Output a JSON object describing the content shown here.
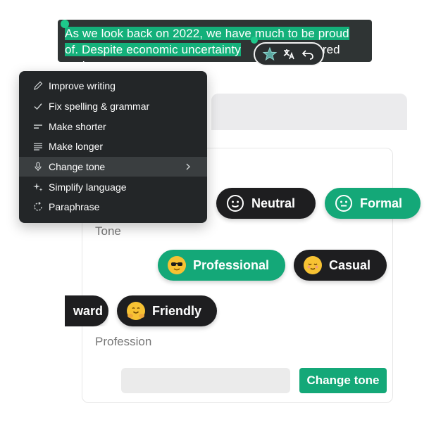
{
  "editor": {
    "line1": "As we look back on 2022, we have much to be proud",
    "line2_selected": "of. Despite economic uncertainty",
    "line2_rest": "red and"
  },
  "mini_toolbar": {
    "icons": [
      "ai-star-icon",
      "translate-icon",
      "undo-icon"
    ]
  },
  "ai_menu": {
    "items": [
      {
        "label": "Improve writing",
        "icon": "pencil-icon"
      },
      {
        "label": "Fix spelling & grammar",
        "icon": "check-icon"
      },
      {
        "label": "Make shorter",
        "icon": "short-lines-icon"
      },
      {
        "label": "Make longer",
        "icon": "long-lines-icon"
      },
      {
        "label": "Change tone",
        "icon": "microphone-icon",
        "active": true,
        "has_submenu": true
      },
      {
        "label": "Simplify language",
        "icon": "sparkles-icon"
      },
      {
        "label": "Paraphrase",
        "icon": "refresh-icon"
      }
    ]
  },
  "tone_panel": {
    "tone_label": "Tone",
    "profession_label": "Profession",
    "chips": {
      "neutral": "Neutral",
      "formal": "Formal",
      "professional": "Professional",
      "casual": "Casual",
      "straightforward_partial": "ward",
      "friendly": "Friendly"
    },
    "button": "Change tone"
  },
  "colors": {
    "accent_green": "#14a878",
    "dark_chip": "#1e1e20",
    "menu_bg": "#232628"
  }
}
